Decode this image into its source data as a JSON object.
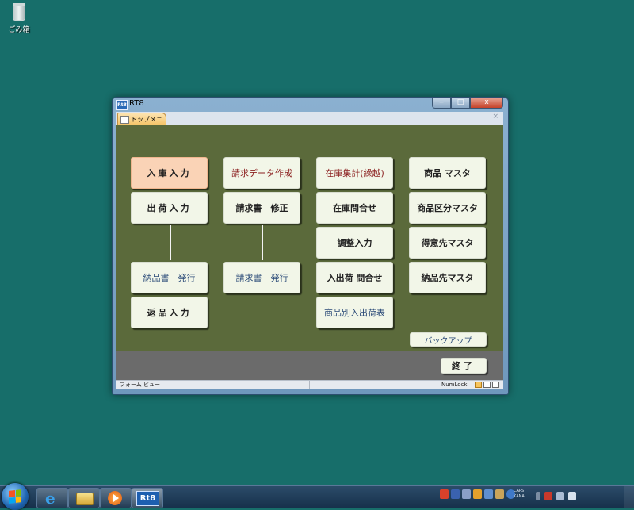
{
  "desktop": {
    "recycle_bin_label": "ごみ箱"
  },
  "window": {
    "title": "RT8",
    "app_icon_text": "Rt8",
    "controls": {
      "minimize": "‒",
      "maximize": "□",
      "close": "x"
    }
  },
  "document_tab": {
    "label": "トップメニュー",
    "close_glyph": "×"
  },
  "menu": {
    "column1": {
      "stock_in": "入庫入力",
      "shipment": "出荷入力",
      "delivery_note": "納品書　発行",
      "return": "返品入力"
    },
    "column2": {
      "invoice_data": "請求データ作成",
      "invoice_fix": "請求書　修正",
      "invoice_issue": "請求書　発行"
    },
    "column3": {
      "stock_summary": "在庫集計(繰越)",
      "stock_inquiry": "在庫問合せ",
      "adjustment": "調整入力",
      "io_inquiry": "入出荷 問合せ",
      "product_io_table": "商品別入出荷表"
    },
    "column4": {
      "product_master": "商品 マスタ",
      "product_category_master": "商品区分マスタ",
      "customer_master": "得意先マスタ",
      "delivery_master": "納品先マスタ",
      "backup": "バックアップ"
    }
  },
  "footer": {
    "exit": "終了"
  },
  "statusbar": {
    "view_mode": "フォーム ビュー",
    "numlock": "NumLock"
  },
  "taskbar": {
    "app_button_text": "Rt8",
    "caps_line1": "CAPS",
    "caps_line2": "KANA"
  },
  "colors": {
    "desktop": "#176e6a",
    "form_background": "#5b6a3b",
    "footer_background": "#6b6b6b",
    "button_face": "#f2f6e8",
    "button_active": "#fad3b6",
    "text_red": "#8b1f1f",
    "text_blue": "#2b4b78"
  }
}
